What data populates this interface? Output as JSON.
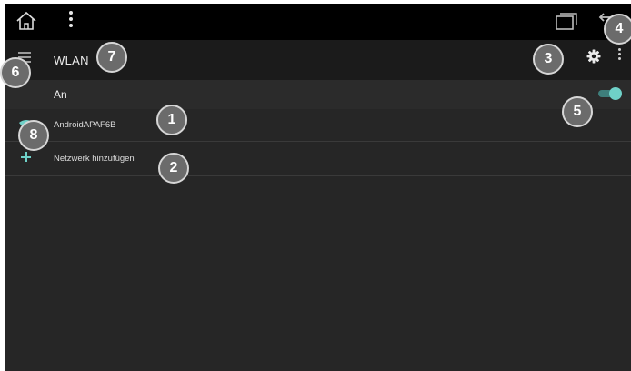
{
  "system_bar": {
    "icons": [
      "home-icon",
      "overflow-menu-icon",
      "recents-icon",
      "back-icon"
    ]
  },
  "action_bar": {
    "title": "WLAN",
    "icons": [
      "drawer-menu-icon",
      "gear-icon",
      "overflow-menu-icon"
    ]
  },
  "switch_row": {
    "label": "An",
    "toggle_on": true
  },
  "networks": [
    {
      "name": "AndroidAPAF6B",
      "icon": "wifi-icon"
    }
  ],
  "add_network": {
    "label": "Netzwerk hinzufügen",
    "icon": "plus-icon"
  },
  "markers": [
    "1",
    "2",
    "3",
    "4",
    "5",
    "6",
    "7",
    "8"
  ],
  "colors": {
    "accent": "#6fd1c8",
    "background": "#262626",
    "action_bar": "#1b1b1b",
    "system_bar": "#000000",
    "marker_fill": "#6b6b6b"
  }
}
